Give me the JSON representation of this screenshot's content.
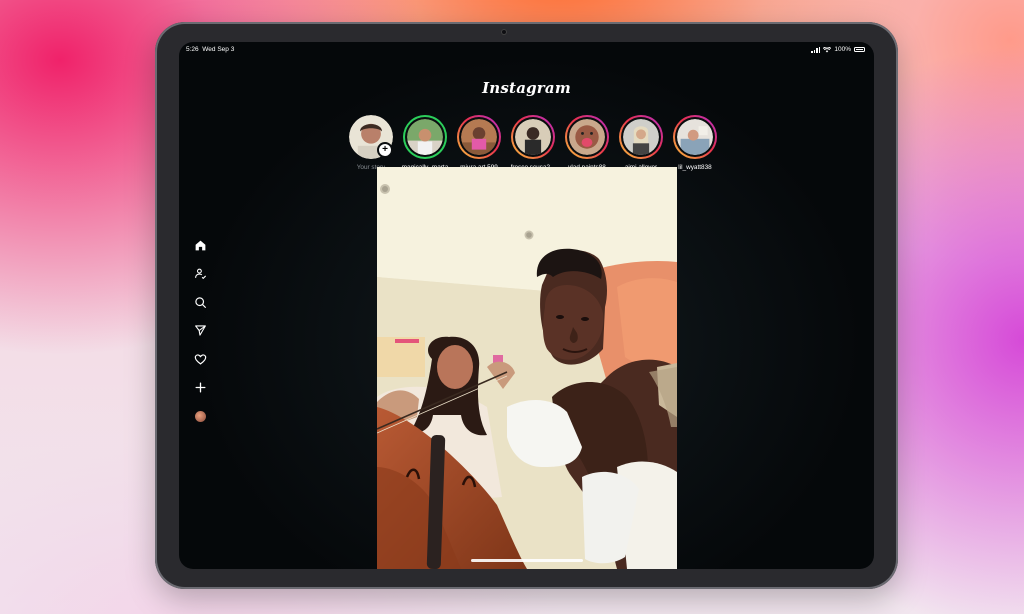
{
  "status_bar": {
    "time": "5:26",
    "date": "Wed Sep 3",
    "battery": "100%"
  },
  "app": {
    "logo": "Instagram"
  },
  "sidebar": {
    "items": [
      {
        "icon": "home-icon"
      },
      {
        "icon": "people-icon"
      },
      {
        "icon": "search-icon"
      },
      {
        "icon": "send-icon"
      },
      {
        "icon": "heart-icon"
      },
      {
        "icon": "plus-icon"
      },
      {
        "icon": "profile-avatar"
      }
    ]
  },
  "stories": [
    {
      "username": "Your story",
      "own": true
    },
    {
      "username": "magically_marta",
      "close_friend": true
    },
    {
      "username": "miura.art.599"
    },
    {
      "username": "fresco.scusa2..."
    },
    {
      "username": "vlad.paints88"
    },
    {
      "username": "aimi.allover"
    },
    {
      "username": "lil_wyatt838"
    }
  ],
  "colors": {
    "story_ring_gradient": [
      "#f9c43c",
      "#e8304d",
      "#b52ecb"
    ],
    "close_friend_ring": "#2ccf5b",
    "screen_background": "#05080a"
  }
}
